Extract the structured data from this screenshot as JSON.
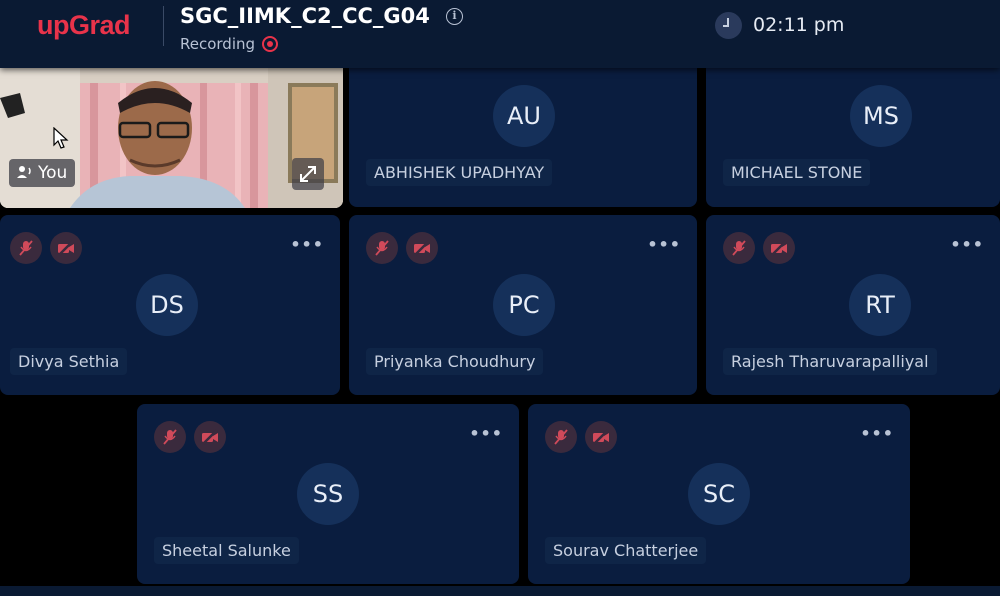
{
  "header": {
    "logo": "upGrad",
    "meeting_title": "SGC_IIMK_C2_CC_G04",
    "recording_label": "Recording",
    "time": "02:11 pm"
  },
  "self_tile": {
    "label": "You"
  },
  "participants": [
    {
      "initials": "AU",
      "name": "ABHISHEK UPADHYAY"
    },
    {
      "initials": "MS",
      "name": "MICHAEL STONE"
    },
    {
      "initials": "DS",
      "name": "Divya Sethia"
    },
    {
      "initials": "PC",
      "name": "Priyanka Choudhury"
    },
    {
      "initials": "RT",
      "name": "Rajesh Tharuvarapalliyal"
    },
    {
      "initials": "SS",
      "name": "Sheetal Salunke"
    },
    {
      "initials": "SC",
      "name": "Sourav Chatterjee"
    }
  ],
  "more_label": "•••",
  "colors": {
    "brand": "#e8334a",
    "tile_bg": "#0a1d3f",
    "header_bg": "#0a1a33"
  }
}
